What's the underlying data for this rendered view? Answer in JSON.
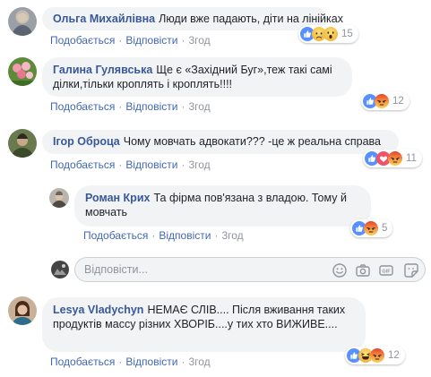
{
  "comments": [
    {
      "author": "Ольга Михайлівна",
      "text": "Люди вже падають, діти на лінійках",
      "like": "Подобається",
      "reply": "Відповісти",
      "time": "3год",
      "reaction_count": "15",
      "reactions": [
        "like-icon",
        "sad-icon",
        "wow-icon"
      ]
    },
    {
      "author": "Галина Гулявська",
      "text": "Ще є «Західний Буг»,теж такі самі ділки,тільки кроплять і кроплять!!!!",
      "like": "Подобається",
      "reply": "Відповісти",
      "time": "3год",
      "reaction_count": "12",
      "reactions": [
        "like-icon",
        "angry-icon"
      ]
    },
    {
      "author": "Ігор Оброца",
      "text": "Чому мовчать адвокати??? -це ж реальна справа",
      "like": "Подобається",
      "reply": "Відповісти",
      "time": "3год",
      "reaction_count": "11",
      "reactions": [
        "like-icon",
        "love-icon",
        "angry-icon"
      ]
    },
    {
      "author": "Роман Крих",
      "text": "Та фірма пов'язана з владою. Тому й мовчать",
      "like": "Подобається",
      "reply": "Відповісти",
      "time": "3год",
      "reaction_count": "5",
      "reactions": [
        "like-icon",
        "angry-icon"
      ]
    },
    {
      "author": "Lesya Vladychyn",
      "text": "НЕМАЄ СЛІВ.... Після вживання таких продуктів массу різних ХВОРІБ....у тих хто ВИЖИВЕ....",
      "like": "Подобається",
      "reply": "Відповісти",
      "time": "3год",
      "reaction_count": "12",
      "reactions": [
        "like-icon",
        "haha-icon",
        "angry-icon"
      ]
    }
  ],
  "reply_box": {
    "placeholder": "Відповісти...",
    "icons": [
      "emoji-icon",
      "camera-icon",
      "gif-icon",
      "sticker-icon"
    ]
  },
  "colors": {
    "link": "#4267b2",
    "author": "#385898",
    "bubble": "#f2f3f5",
    "meta": "#90949c",
    "like_blue": "#5890ff",
    "angry_orange": "#f0683d",
    "love_red": "#f25268",
    "emoji_yellow": "#f7c94b"
  }
}
